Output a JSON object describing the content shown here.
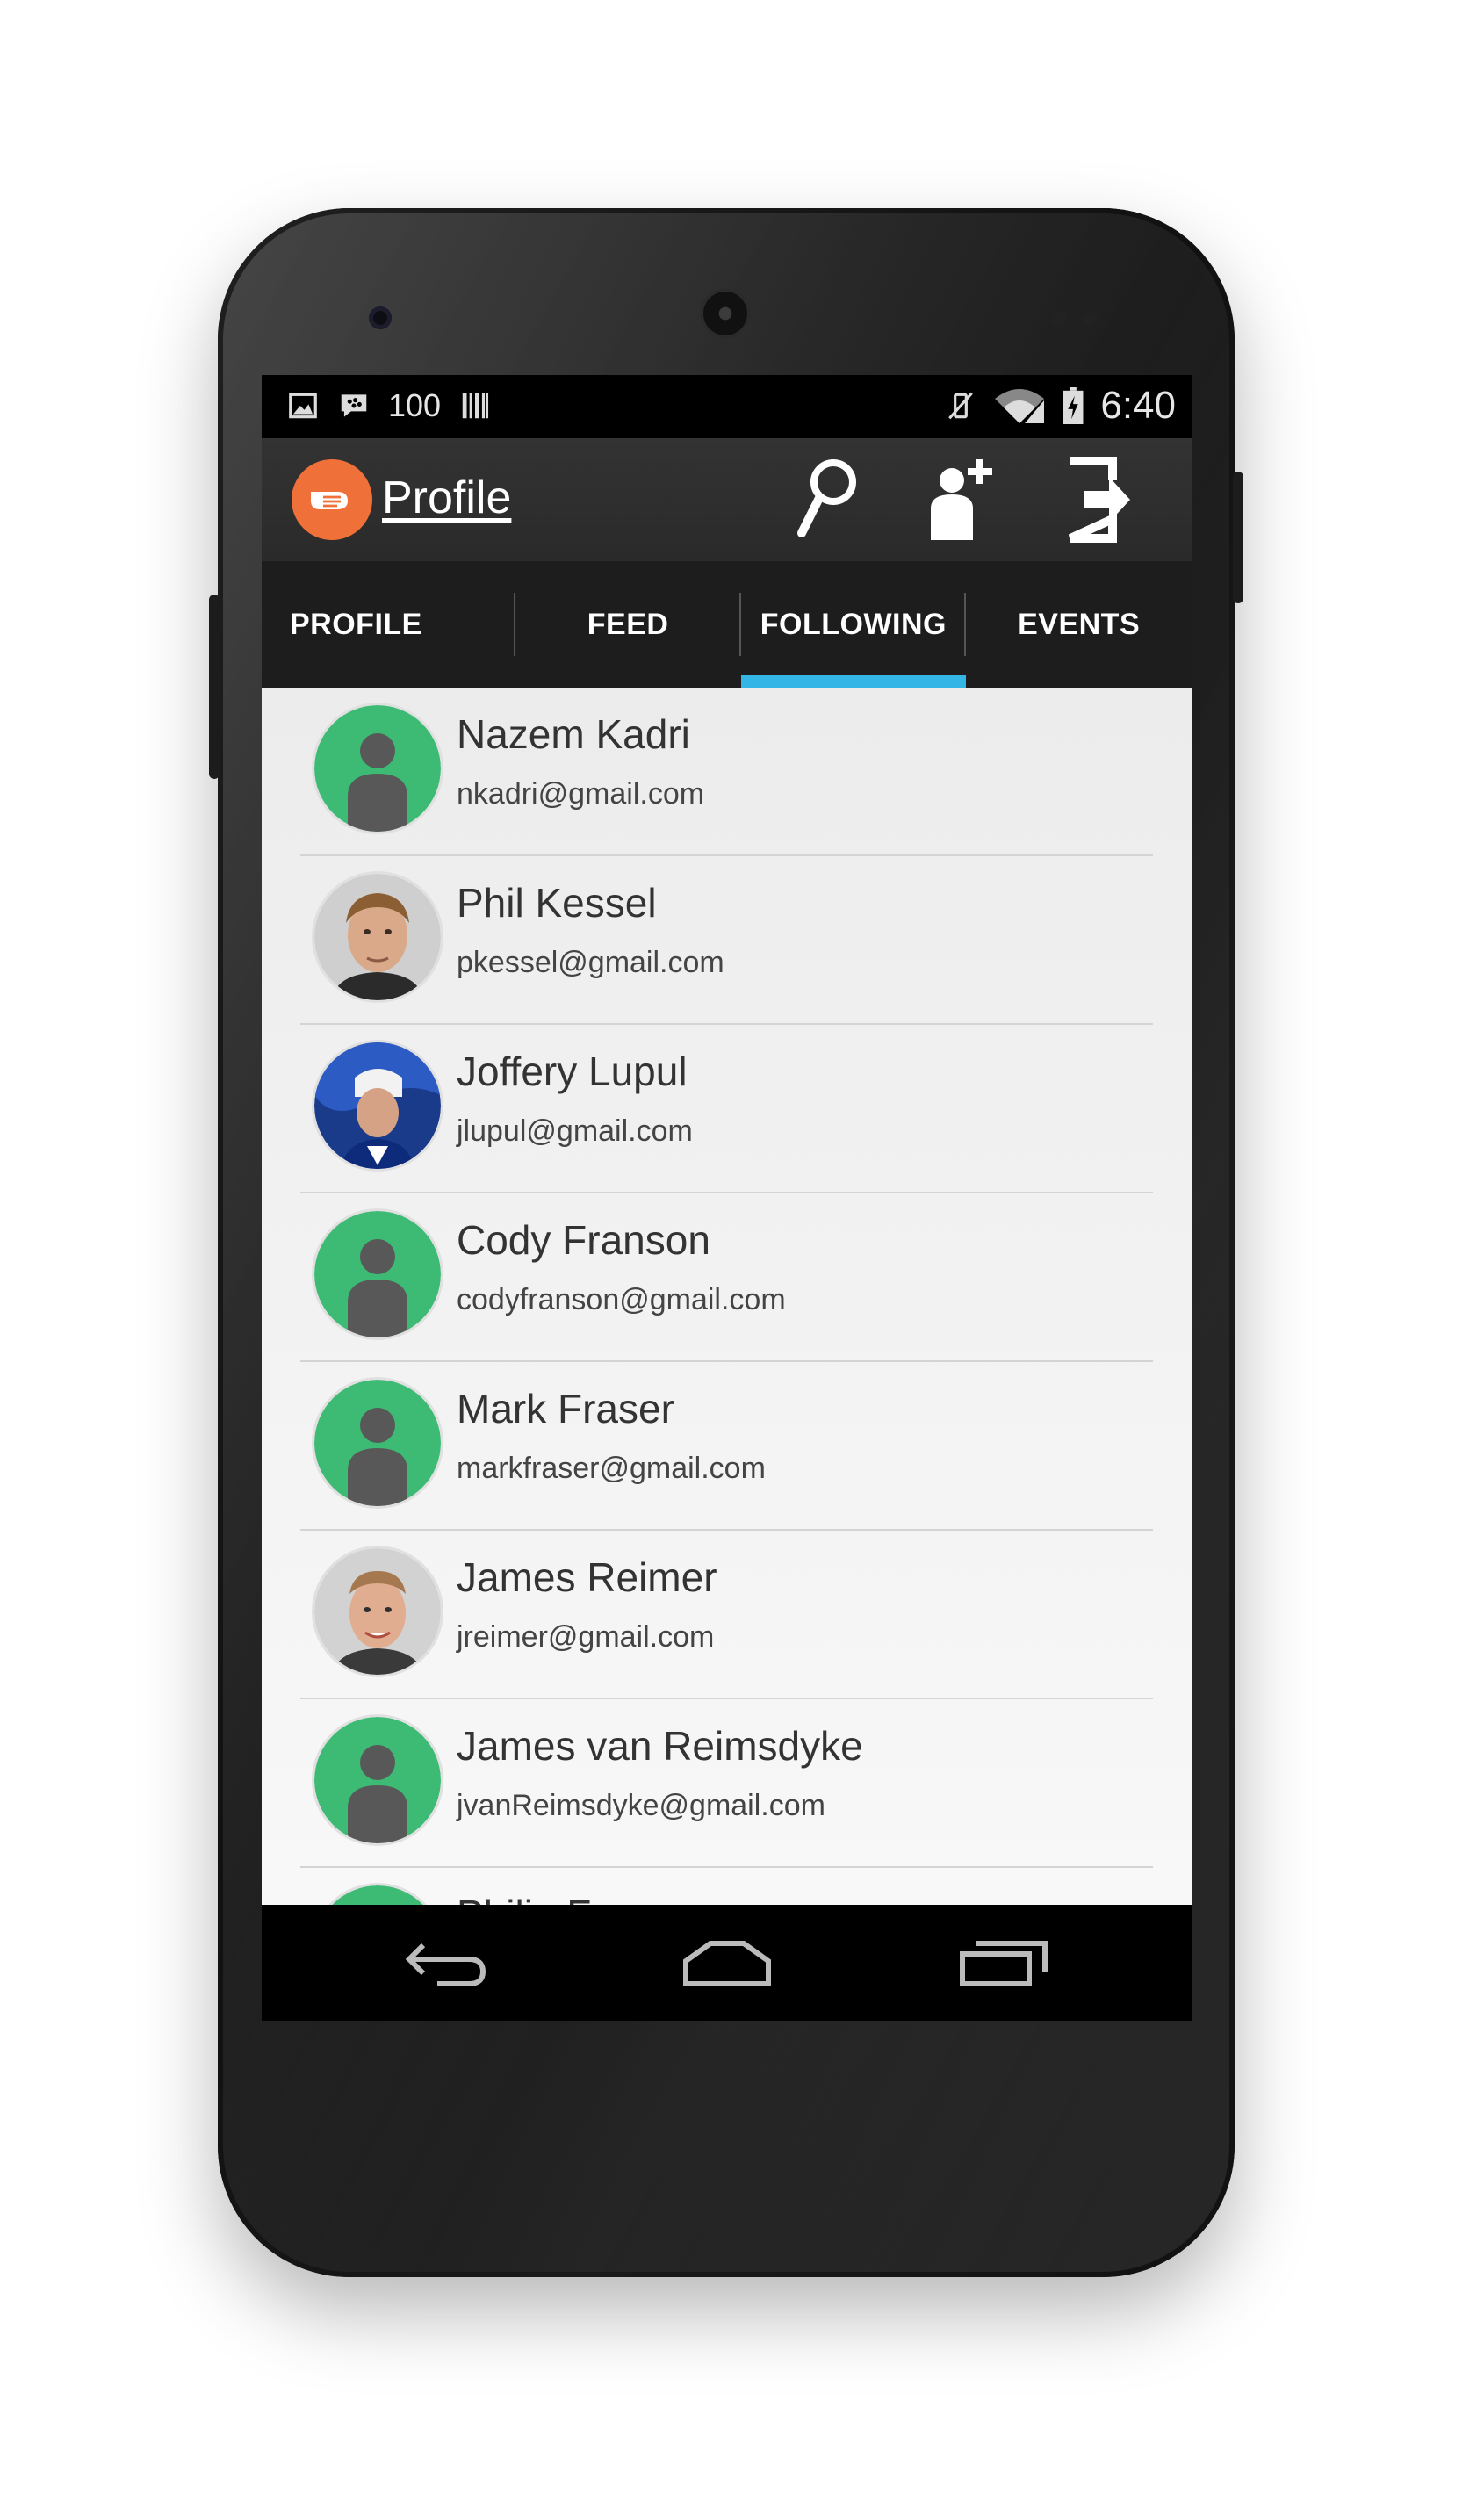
{
  "status_bar": {
    "notification_count": "100",
    "time": "6:40"
  },
  "action_bar": {
    "title": "Profile"
  },
  "tabs": [
    {
      "label": "PROFILE",
      "selected": false
    },
    {
      "label": "FEED",
      "selected": false
    },
    {
      "label": "FOLLOWING",
      "selected": true
    },
    {
      "label": "EVENTS",
      "selected": false
    }
  ],
  "following": [
    {
      "name": "Nazem Kadri",
      "email": "nkadri@gmail.com",
      "avatar": "default-avatar"
    },
    {
      "name": "Phil Kessel",
      "email": "pkessel@gmail.com",
      "avatar": "photo"
    },
    {
      "name": "Joffery Lupul",
      "email": "jlupul@gmail.com",
      "avatar": "photo"
    },
    {
      "name": "Cody Franson",
      "email": "codyfranson@gmail.com",
      "avatar": "default-avatar"
    },
    {
      "name": "Mark Fraser",
      "email": "markfraser@gmail.com",
      "avatar": "default-avatar"
    },
    {
      "name": "James Reimer",
      "email": "jreimer@gmail.com",
      "avatar": "photo"
    },
    {
      "name": "James van Reimsdyke",
      "email": "jvanReimsdyke@gmail.com",
      "avatar": "default-avatar"
    },
    {
      "name": "Philip F...",
      "email": "",
      "avatar": "default-avatar"
    }
  ],
  "colors": {
    "accent": "#33b5e5",
    "logo": "#f0703a",
    "default_avatar": "#3dba74"
  }
}
